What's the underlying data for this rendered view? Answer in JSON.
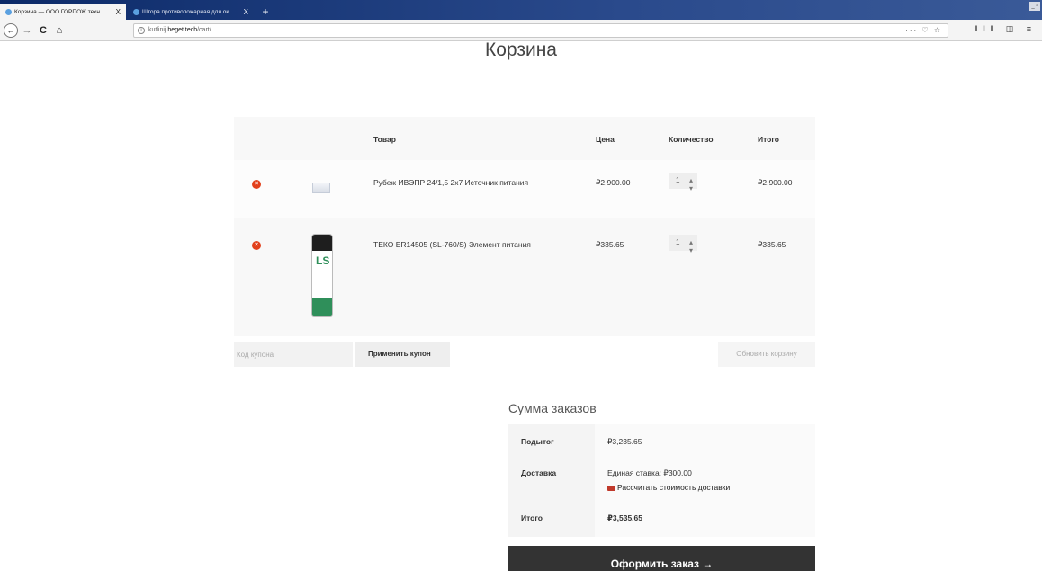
{
  "browser": {
    "tabs": [
      {
        "title": "Корзина — ООО ГОРПОЖ техн",
        "close": "X",
        "active": true
      },
      {
        "title": "Штора противопожарная для ок",
        "close": "X",
        "active": false
      }
    ],
    "new_tab": "+",
    "nav": {
      "back": "←",
      "forward": "→",
      "reload": "C",
      "home": "⌂"
    },
    "url": {
      "info": "i",
      "prefix": "kutlinij.",
      "domain": "beget.tech",
      "path": "/cart/"
    },
    "url_actions": "··· ♡ ☆",
    "toolbar_right": "III ◫ ≡",
    "window_controls": "_ ▫"
  },
  "page": {
    "title": "Корзина",
    "cart": {
      "headers": {
        "product": "Товар",
        "price": "Цена",
        "quantity": "Количество",
        "total": "Итого"
      },
      "items": [
        {
          "remove": "×",
          "name": "Рубеж ИВЭПР 24/1,5 2х7 Источник питания",
          "price": "₽2,900.00",
          "quantity": "1",
          "subtotal": "₽2,900.00",
          "image_icon": "power-supply-icon"
        },
        {
          "remove": "×",
          "name": "ТЕКО ER14505 (SL-760/S) Элемент питания",
          "price": "₽335.65",
          "quantity": "1",
          "subtotal": "₽335.65",
          "image_icon": "battery-icon",
          "image_text": "LS"
        }
      ],
      "coupon_placeholder": "Код купона",
      "apply_coupon": "Применить купон",
      "update_cart": "Обновить корзину"
    },
    "totals": {
      "title": "Сумма заказов",
      "subtotal_label": "Подытог",
      "subtotal_value": "₽3,235.65",
      "shipping_label": "Доставка",
      "shipping_value": "Единая ставка: ₽300.00",
      "shipping_calc": "Рассчитать стоимость доставки",
      "total_label": "Итого",
      "total_value": "₽3,535.65"
    },
    "checkout_button": "Оформить заказ →"
  },
  "colors": {
    "remove_red": "#e2401c",
    "checkout_bg": "#333333",
    "tabbar": "#0f2f6e"
  }
}
